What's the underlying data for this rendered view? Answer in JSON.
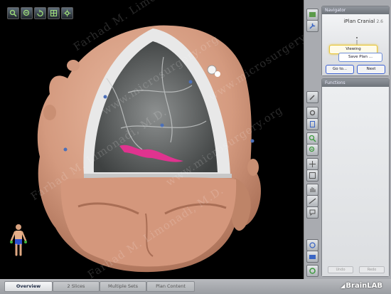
{
  "viewport": {
    "toolbar": [
      "zoom-in-icon",
      "zoom-out-icon",
      "rotate-icon",
      "layout-icon",
      "settings-icon"
    ],
    "watermark_lines": [
      "Farhad M. Limonadi, M.D.",
      "www.microsurgery.org",
      "Farhad M. Limonadi, M.D.",
      "www.microsurgery.org",
      "Farhad M. Limonadi, M.D.",
      "www.microsurgery.org"
    ]
  },
  "navigator": {
    "header": "Navigator",
    "app_name": "iPlan Cranial",
    "version": "2.6",
    "viewing_label": "Viewing",
    "save_plan_label": "Save Plan ...",
    "goto_label": "Go to...",
    "next_label": "Next"
  },
  "functions": {
    "header": "Functions",
    "undo_label": "Undo",
    "redo_label": "Redo"
  },
  "tabs": [
    {
      "label": "Overview",
      "active": true
    },
    {
      "label": "2 Slices",
      "active": false
    },
    {
      "label": "Multiple Sets",
      "active": false
    },
    {
      "label": "Plan Content",
      "active": false
    }
  ],
  "brand": "BrainLAB",
  "colors": {
    "accent_yellow": "#e8c63a",
    "accent_blue": "#3b5fd0",
    "skin": "#d8a287",
    "vessel": "#e0338f"
  }
}
